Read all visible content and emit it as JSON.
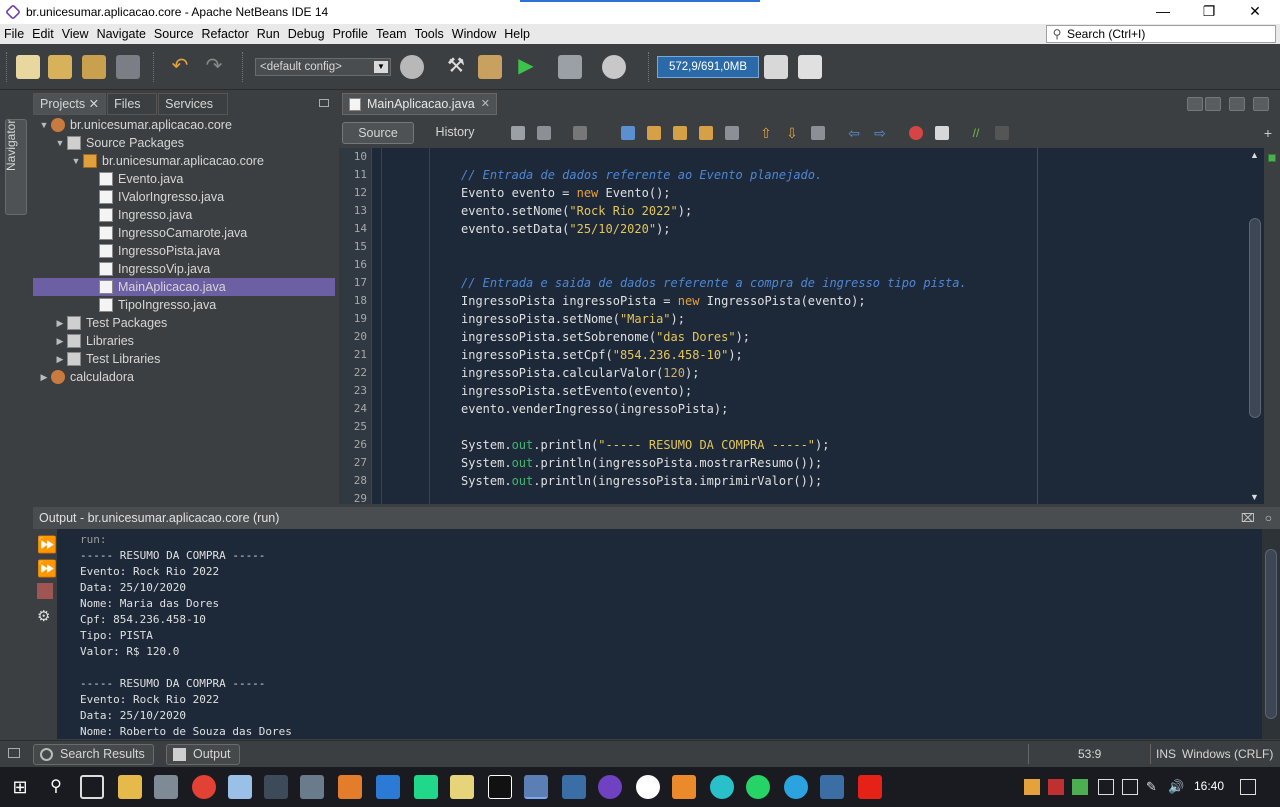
{
  "window": {
    "title": "br.unicesumar.aplicacao.core - Apache NetBeans IDE 14",
    "controls": [
      "—",
      "❐",
      "✕"
    ]
  },
  "menu": [
    "File",
    "Edit",
    "View",
    "Navigate",
    "Source",
    "Refactor",
    "Run",
    "Debug",
    "Profile",
    "Team",
    "Tools",
    "Window",
    "Help"
  ],
  "search": {
    "placeholder": "Search (Ctrl+I)"
  },
  "toolbar": {
    "config": "<default config>",
    "memory": "572,9/691,0MB"
  },
  "left_panel": {
    "navigator_label": "Navigator",
    "tabs": [
      "Projects",
      "Files",
      "Services"
    ],
    "tree": [
      {
        "label": "br.unicesumar.aplicacao.core",
        "level": 0,
        "toggle": "▼",
        "icon": "project"
      },
      {
        "label": "Source Packages",
        "level": 1,
        "toggle": "▼",
        "icon": "folder"
      },
      {
        "label": "br.unicesumar.aplicacao.core",
        "level": 2,
        "toggle": "▼",
        "icon": "package"
      },
      {
        "label": "Evento.java",
        "level": 3,
        "toggle": "",
        "icon": "java"
      },
      {
        "label": "IValorIngresso.java",
        "level": 3,
        "toggle": "",
        "icon": "java"
      },
      {
        "label": "Ingresso.java",
        "level": 3,
        "toggle": "",
        "icon": "java"
      },
      {
        "label": "IngressoCamarote.java",
        "level": 3,
        "toggle": "",
        "icon": "java"
      },
      {
        "label": "IngressoPista.java",
        "level": 3,
        "toggle": "",
        "icon": "java"
      },
      {
        "label": "IngressoVip.java",
        "level": 3,
        "toggle": "",
        "icon": "java"
      },
      {
        "label": "MainAplicacao.java",
        "level": 3,
        "toggle": "",
        "icon": "java",
        "selected": true
      },
      {
        "label": "TipoIngresso.java",
        "level": 3,
        "toggle": "",
        "icon": "java"
      },
      {
        "label": "Test Packages",
        "level": 1,
        "toggle": "▶",
        "icon": "folder"
      },
      {
        "label": "Libraries",
        "level": 1,
        "toggle": "▶",
        "icon": "folder"
      },
      {
        "label": "Test Libraries",
        "level": 1,
        "toggle": "▶",
        "icon": "folder"
      },
      {
        "label": "calculadora",
        "level": 0,
        "toggle": "▶",
        "icon": "project"
      }
    ]
  },
  "editor": {
    "tab_label": "MainAplicacao.java",
    "modes": [
      "Source",
      "History"
    ],
    "lines": [
      {
        "n": "10",
        "code": ""
      },
      {
        "n": "11",
        "code": "// Entrada de dados referente ao Evento planejado."
      },
      {
        "n": "12",
        "code": "Evento evento = new Evento();"
      },
      {
        "n": "13",
        "code": "evento.setNome(\"Rock Rio 2022\");"
      },
      {
        "n": "14",
        "code": "evento.setData(\"25/10/2020\");"
      },
      {
        "n": "15",
        "code": ""
      },
      {
        "n": "16",
        "code": ""
      },
      {
        "n": "17",
        "code": "// Entrada e saida de dados referente a compra de ingresso tipo pista."
      },
      {
        "n": "18",
        "code": "IngressoPista ingressoPista = new IngressoPista(evento);"
      },
      {
        "n": "19",
        "code": "ingressoPista.setNome(\"Maria\");"
      },
      {
        "n": "20",
        "code": "ingressoPista.setSobrenome(\"das Dores\");"
      },
      {
        "n": "21",
        "code": "ingressoPista.setCpf(\"854.236.458-10\");"
      },
      {
        "n": "22",
        "code": "ingressoPista.calcularValor(120);"
      },
      {
        "n": "23",
        "code": "ingressoPista.setEvento(evento);"
      },
      {
        "n": "24",
        "code": "evento.venderIngresso(ingressoPista);"
      },
      {
        "n": "25",
        "code": ""
      },
      {
        "n": "26",
        "code": "System.out.println(\"----- RESUMO DA COMPRA -----\");"
      },
      {
        "n": "27",
        "code": "System.out.println(ingressoPista.mostrarResumo());"
      },
      {
        "n": "28",
        "code": "System.out.println(ingressoPista.imprimirValor());"
      },
      {
        "n": "29",
        "code": ""
      }
    ]
  },
  "output": {
    "title": "Output - br.unicesumar.aplicacao.core (run)",
    "lines": [
      "run:",
      "----- RESUMO DA COMPRA -----",
      "Evento: Rock Rio 2022",
      "Data: 25/10/2020",
      "Nome: Maria das Dores",
      "Cpf: 854.236.458-10",
      "Tipo: PISTA",
      "Valor: R$ 120.0",
      "",
      "----- RESUMO DA COMPRA -----",
      "Evento: Rock Rio 2022",
      "Data: 25/10/2020",
      "Nome: Roberto de Souza das Dores"
    ]
  },
  "bottom": {
    "tabs": [
      "Search Results",
      "Output"
    ],
    "caret": "53:9",
    "insert_mode": "INS",
    "line_endings": "Windows (CRLF)"
  },
  "taskbar": {
    "time": "16:40"
  },
  "colors": {
    "editor_bg": "#1d2838",
    "comment": "#4e87d4",
    "keyword": "#e8a13a",
    "string": "#e4c65a",
    "selection": "#6c5fa3",
    "memory_bar": "#2a6aa8"
  }
}
